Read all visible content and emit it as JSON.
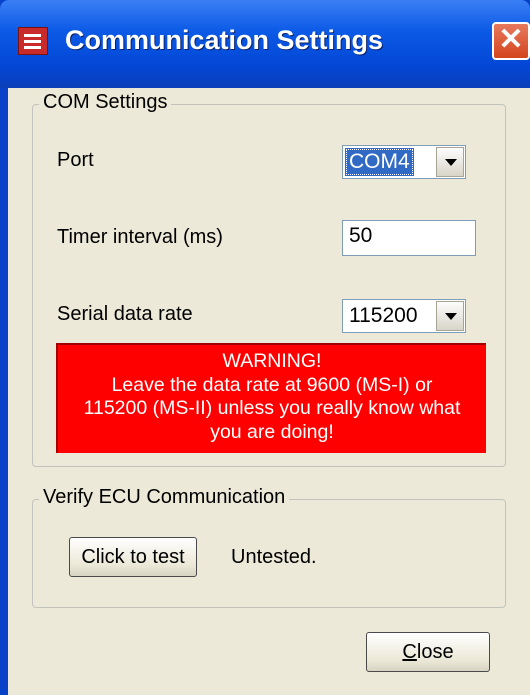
{
  "window": {
    "title": "Communication Settings"
  },
  "com_settings": {
    "group_title": "COM Settings",
    "port_label": "Port",
    "port_value": "COM4",
    "timer_label": "Timer interval (ms)",
    "timer_value": "50",
    "rate_label": "Serial data rate",
    "rate_value": "115200",
    "warning_lines": [
      "WARNING!",
      "Leave the data rate at 9600 (MS-I) or",
      "115200 (MS-II) unless you really know what",
      "you are doing!"
    ]
  },
  "verify": {
    "group_title": "Verify ECU Communication",
    "test_button": "Click to test",
    "status": "Untested."
  },
  "footer": {
    "close_button": "Close"
  },
  "colors": {
    "warning_bg": "#ff0000",
    "title_bar": "#0c5ae6",
    "dialog_bg": "#ece9d8"
  }
}
